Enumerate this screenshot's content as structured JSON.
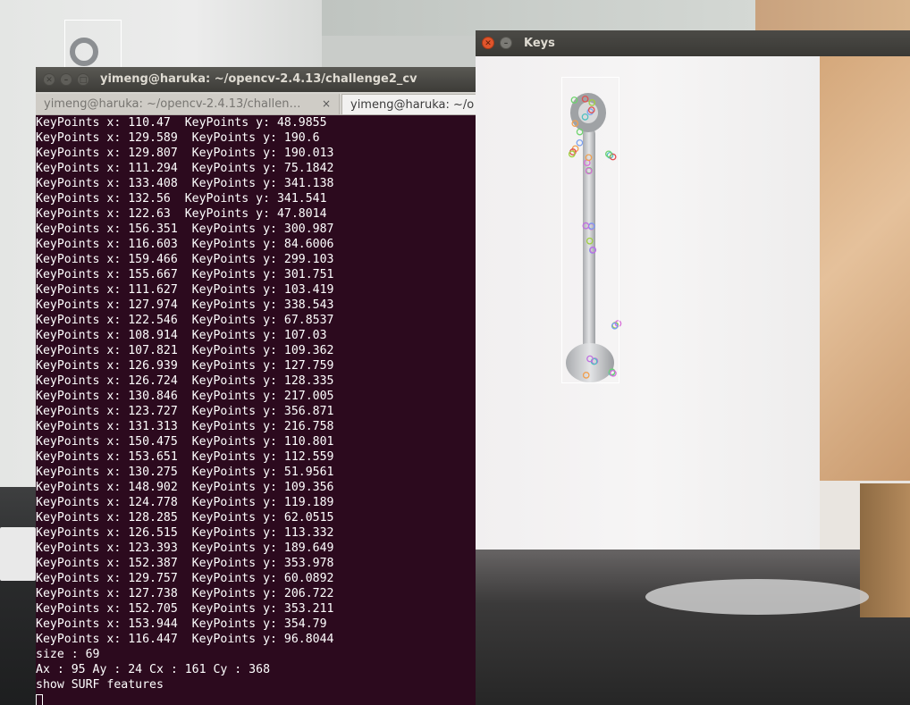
{
  "terminal": {
    "title": "yimeng@haruka: ~/opencv-2.4.13/challenge2_cv",
    "tabs": [
      {
        "label": "yimeng@haruka: ~/opencv-2.4.13/challen…",
        "close": "×"
      },
      {
        "label": "yimeng@haruka: ~/o"
      }
    ],
    "lines": [
      "KeyPoints x: 110.47  KeyPoints y: 48.9855",
      "KeyPoints x: 129.589  KeyPoints y: 190.6",
      "KeyPoints x: 129.807  KeyPoints y: 190.013",
      "KeyPoints x: 111.294  KeyPoints y: 75.1842",
      "KeyPoints x: 133.408  KeyPoints y: 341.138",
      "KeyPoints x: 132.56  KeyPoints y: 341.541",
      "KeyPoints x: 122.63  KeyPoints y: 47.8014",
      "KeyPoints x: 156.351  KeyPoints y: 300.987",
      "KeyPoints x: 116.603  KeyPoints y: 84.6006",
      "KeyPoints x: 159.466  KeyPoints y: 299.103",
      "KeyPoints x: 155.667  KeyPoints y: 301.751",
      "KeyPoints x: 111.627  KeyPoints y: 103.419",
      "KeyPoints x: 127.974  KeyPoints y: 338.543",
      "KeyPoints x: 122.546  KeyPoints y: 67.8537",
      "KeyPoints x: 108.914  KeyPoints y: 107.03",
      "KeyPoints x: 107.821  KeyPoints y: 109.362",
      "KeyPoints x: 126.939  KeyPoints y: 127.759",
      "KeyPoints x: 126.724  KeyPoints y: 128.335",
      "KeyPoints x: 130.846  KeyPoints y: 217.005",
      "KeyPoints x: 123.727  KeyPoints y: 356.871",
      "KeyPoints x: 131.313  KeyPoints y: 216.758",
      "KeyPoints x: 150.475  KeyPoints y: 110.801",
      "KeyPoints x: 153.651  KeyPoints y: 112.559",
      "KeyPoints x: 130.275  KeyPoints y: 51.9561",
      "KeyPoints x: 148.902  KeyPoints y: 109.356",
      "KeyPoints x: 124.778  KeyPoints y: 119.189",
      "KeyPoints x: 128.285  KeyPoints y: 62.0515",
      "KeyPoints x: 126.515  KeyPoints y: 113.332",
      "KeyPoints x: 123.393  KeyPoints y: 189.649",
      "KeyPoints x: 152.387  KeyPoints y: 353.978",
      "KeyPoints x: 129.757  KeyPoints y: 60.0892",
      "KeyPoints x: 127.738  KeyPoints y: 206.722",
      "KeyPoints x: 152.705  KeyPoints y: 353.211",
      "KeyPoints x: 153.944  KeyPoints y: 354.79",
      "KeyPoints x: 116.447  KeyPoints y: 96.8044",
      "size : 69",
      "Ax : 95 Ay : 24 Cx : 161 Cy : 368",
      "show SURF features"
    ],
    "colors": {
      "background": "#2c0a1e",
      "text": "#ffffff"
    }
  },
  "keys_window": {
    "title": "Keys",
    "colors": {
      "close_button": "#e0552c",
      "bounding_box": "#ffffff"
    },
    "keypoint_colors": [
      "#6fd36f",
      "#d86fd8",
      "#7aa0f0",
      "#f0a050",
      "#c070e0",
      "#50c0c0",
      "#e05050",
      "#a0d040"
    ]
  }
}
